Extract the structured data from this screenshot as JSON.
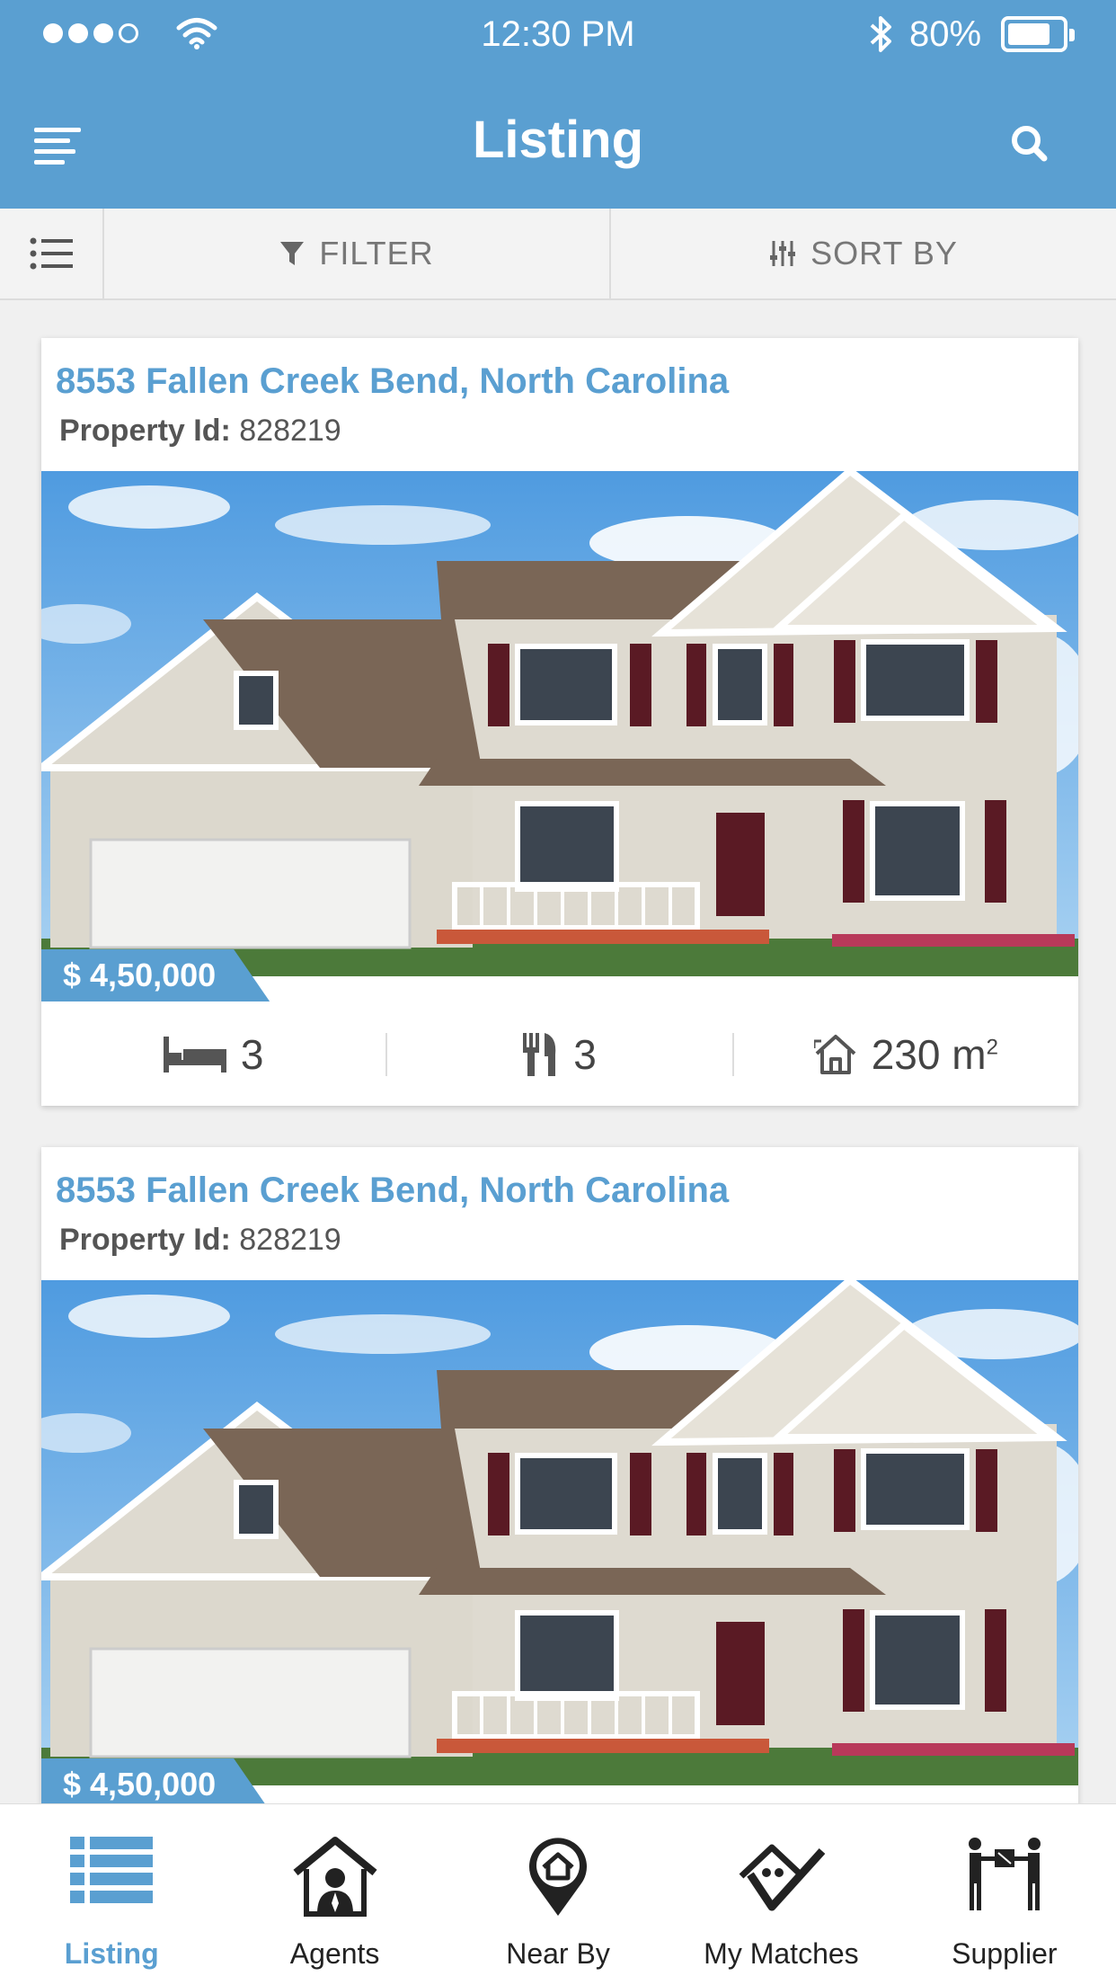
{
  "status_bar": {
    "time": "12:30 PM",
    "battery_text": "80%",
    "battery_level": 0.8
  },
  "header": {
    "title": "Listing"
  },
  "toolbar": {
    "filter_label": "FILTER",
    "sort_label": "SORT BY"
  },
  "listings": [
    {
      "address": "8553 Fallen Creek Bend, North Carolina",
      "property_id_label": "Property Id:",
      "property_id": "828219",
      "price": "$ 4,50,000",
      "bedrooms": "3",
      "kitchens": "3",
      "area": "230 m",
      "area_sup": "2"
    },
    {
      "address": "8553 Fallen Creek Bend, North Carolina",
      "property_id_label": "Property Id:",
      "property_id": "828219",
      "price": "$ 4,50,000"
    }
  ],
  "bottom_nav": {
    "items": [
      {
        "label": "Listing",
        "icon": "list-icon",
        "active": true
      },
      {
        "label": "Agents",
        "icon": "agent-house-icon"
      },
      {
        "label": "Near By",
        "icon": "map-pin-home-icon"
      },
      {
        "label": "My Matches",
        "icon": "matches-icon"
      },
      {
        "label": "Supplier",
        "icon": "supplier-icon"
      }
    ]
  },
  "colors": {
    "primary": "#5a9fd1",
    "toolbar_bg": "#f3f3f3",
    "text_dark": "#444444"
  }
}
